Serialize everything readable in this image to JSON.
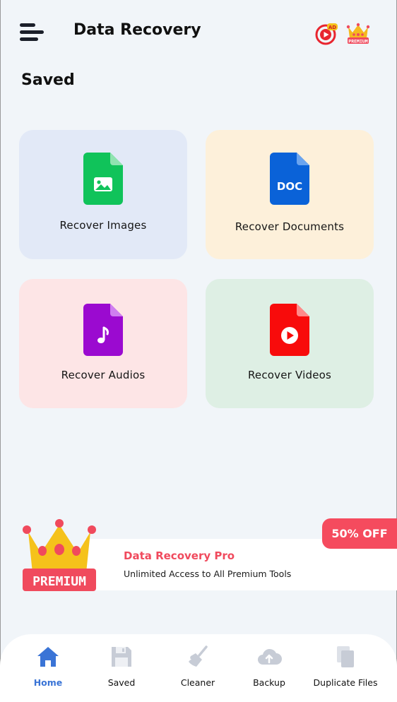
{
  "header": {
    "title": "Data Recovery",
    "ad_badge": "AD",
    "premium_badge": "PREMIUM"
  },
  "section": {
    "title": "Saved"
  },
  "cards": [
    {
      "label": "Recover Images",
      "icon": "image-file-icon",
      "color": "#10c35a",
      "bg": "#e2e9f7"
    },
    {
      "label": "Recover Documents",
      "icon": "doc-file-icon",
      "color": "#0a62d8",
      "bg": "#fdf0da",
      "icon_text": "DOC"
    },
    {
      "label": "Recover Audios",
      "icon": "audio-file-icon",
      "color": "#9b0ad0",
      "bg": "#fde5e6"
    },
    {
      "label": "Recover Videos",
      "icon": "video-file-icon",
      "color": "#f80b0b",
      "bg": "#deefe4"
    }
  ],
  "promo": {
    "title": "Data Recovery Pro",
    "subtitle": "Unlimited Access to All Premium Tools",
    "discount": "50% OFF",
    "crown_label": "PREMIUM"
  },
  "nav": {
    "active": "Home",
    "items": [
      {
        "label": "Home",
        "icon": "home-icon"
      },
      {
        "label": "Saved",
        "icon": "save-icon"
      },
      {
        "label": "Cleaner",
        "icon": "broom-icon"
      },
      {
        "label": "Backup",
        "icon": "cloud-upload-icon"
      },
      {
        "label": "Duplicate Files",
        "icon": "copy-icon"
      }
    ]
  },
  "colors": {
    "accent": "#3a74d6",
    "promo_red": "#f04a5d",
    "background": "#f1f5f9"
  }
}
